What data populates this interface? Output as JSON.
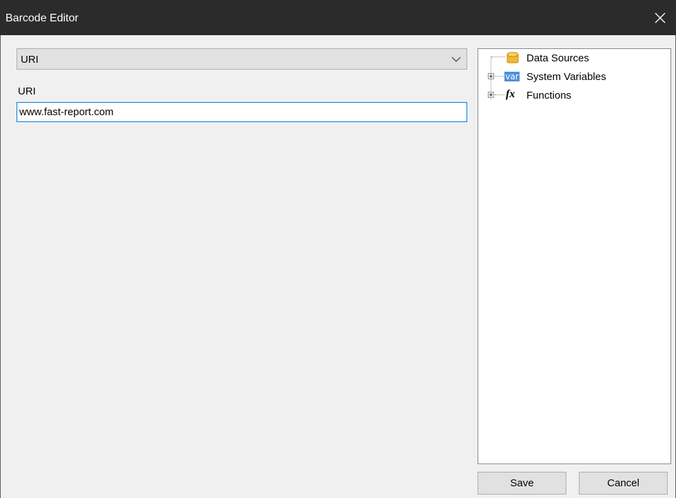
{
  "window": {
    "title": "Barcode Editor",
    "close_icon": "close-icon",
    "titlebar_color": "#2b2b2b"
  },
  "combo": {
    "selected": "URI",
    "icon": "chevron-down-icon"
  },
  "field": {
    "label": "URI",
    "value": "www.fast-report.com"
  },
  "tree": {
    "items": [
      {
        "label": "Data Sources",
        "icon": "database-icon",
        "expandable": false
      },
      {
        "label": "System Variables",
        "icon": "var-icon",
        "icon_text": "var",
        "expandable": true
      },
      {
        "label": "Functions",
        "icon": "function-icon",
        "icon_text": "fx",
        "expandable": true
      }
    ]
  },
  "buttons": {
    "save": "Save",
    "cancel": "Cancel"
  },
  "colors": {
    "accent": "#0078d7",
    "var_icon": "#4f8ede",
    "db_icon": "#f2b632"
  }
}
